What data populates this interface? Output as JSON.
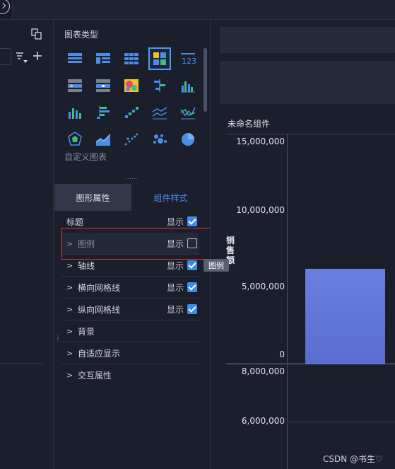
{
  "chart_types": {
    "title": "图表类型",
    "custom_label": "自定义图表",
    "icons": [
      "table-icon",
      "cross-table-icon",
      "grid-table-icon",
      "card-icon",
      "number-icon",
      "list-table-icon",
      "detail-table-icon",
      "heatmap-icon",
      "stacked-bar-icon",
      "bar-chart-icon",
      "column-chart-icon",
      "horizontal-bar-icon",
      "waterfall-icon",
      "line-chart-icon",
      "area-line-icon",
      "radar-icon",
      "area-chart-icon",
      "scatter-icon",
      "bubble-icon",
      "pie-icon"
    ],
    "selected_index": 3
  },
  "tabs": {
    "shape": "图形属性",
    "style": "组件样式"
  },
  "props": {
    "show_label": "显示",
    "rows": [
      {
        "label": "标题",
        "checked": true,
        "expandable": false
      },
      {
        "label": "图例",
        "checked": false,
        "expandable": true
      },
      {
        "label": "轴线",
        "checked": true,
        "expandable": true
      },
      {
        "label": "横向网格线",
        "checked": true,
        "expandable": true
      },
      {
        "label": "纵向网格线",
        "checked": true,
        "expandable": true
      },
      {
        "label": "背景",
        "expandable": true
      },
      {
        "label": "自适应显示",
        "expandable": true
      },
      {
        "label": "交互属性",
        "expandable": true
      }
    ]
  },
  "tooltip": "图例",
  "component": {
    "title": "未命名组件",
    "value_label": "销售额"
  },
  "chart_data": [
    {
      "type": "bar",
      "yticks": [
        "15,000,000",
        "10,000,000",
        "5,000,000",
        "0"
      ],
      "ylim": [
        0,
        15000000
      ],
      "values": [
        6400000
      ],
      "color": "#5e72d8"
    },
    {
      "type": "bar",
      "yticks": [
        "8,000,000",
        "6,000,000"
      ]
    }
  ],
  "watermark": "CSDN @书生♡",
  "colors": {
    "accent": "#3b8de8",
    "highlight_box": "#d93a3a"
  }
}
